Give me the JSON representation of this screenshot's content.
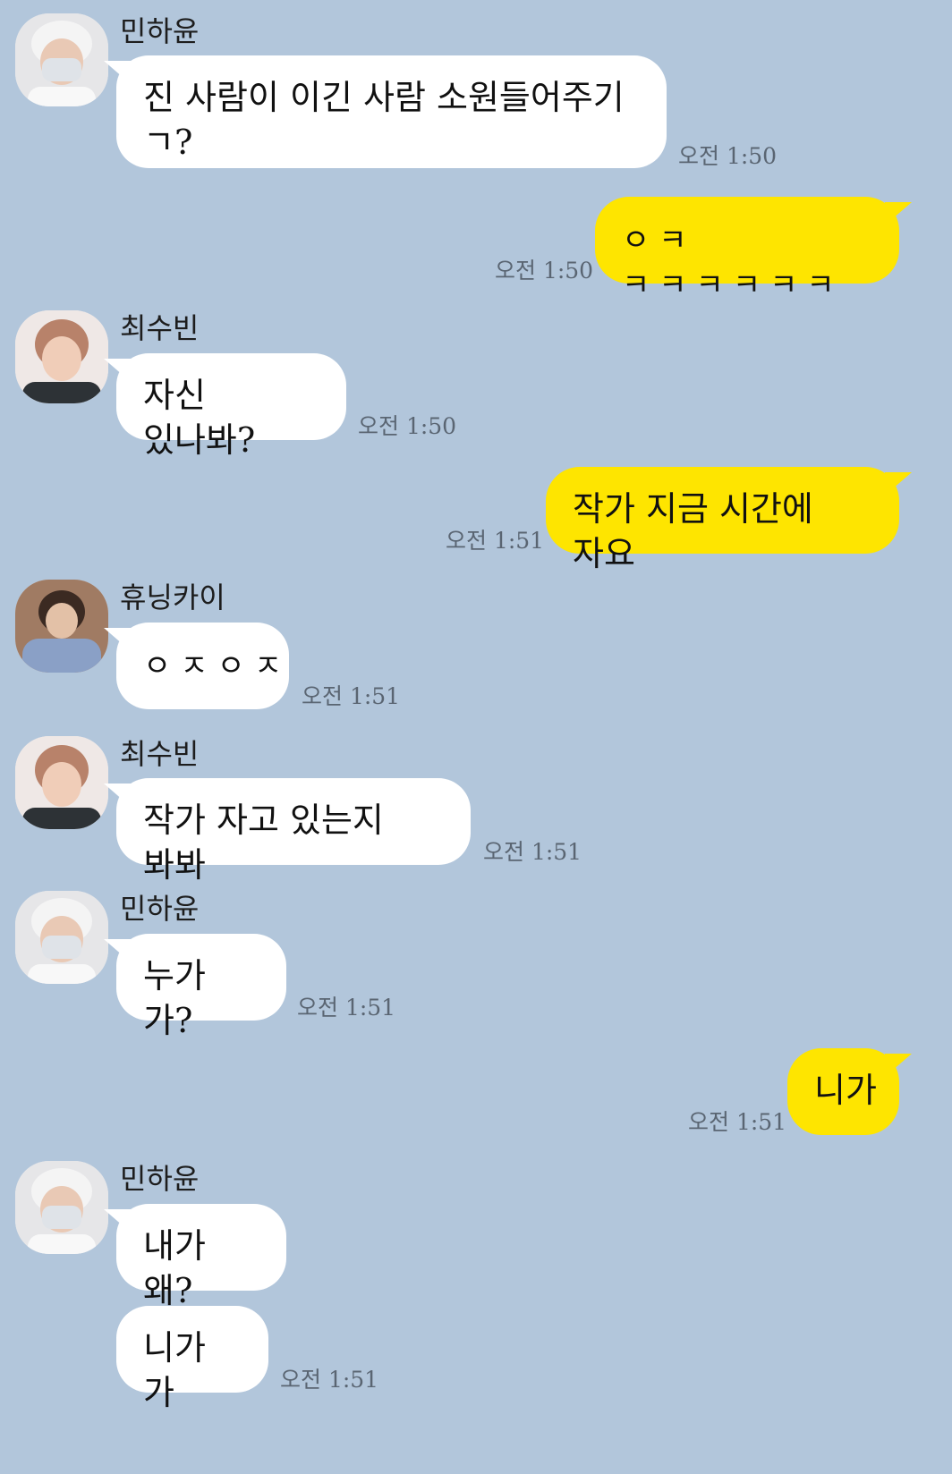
{
  "participants": {
    "minhayun": {
      "name": "민하윤"
    },
    "choisubin": {
      "name": "최수빈"
    },
    "hueningkai": {
      "name": "휴닝카이"
    }
  },
  "messages": [
    {
      "id": "m1",
      "sender": "민하윤",
      "text": "진 사람이 이긴 사람 소원들어주기\nㄱ?",
      "time": "오전 1:50"
    },
    {
      "id": "m2",
      "sender": "me",
      "text": "ㅇㅋ ㅋㅋㅋㅋㅋㅋ",
      "time": "오전 1:50"
    },
    {
      "id": "m3",
      "sender": "최수빈",
      "text": "자신 있나봐?",
      "time": "오전 1:50"
    },
    {
      "id": "m4",
      "sender": "me",
      "text": "작가 지금 시간에 자요",
      "time": "오전 1:51"
    },
    {
      "id": "m5",
      "sender": "휴닝카이",
      "text": "ㅇㅈㅇㅈ",
      "time": "오전 1:51"
    },
    {
      "id": "m6",
      "sender": "최수빈",
      "text": "작가 자고 있는지 봐봐",
      "time": "오전 1:51"
    },
    {
      "id": "m7",
      "sender": "민하윤",
      "text": "누가 가?",
      "time": "오전 1:51"
    },
    {
      "id": "m8",
      "sender": "me",
      "text": "니가",
      "time": "오전 1:51"
    },
    {
      "id": "m9",
      "sender": "민하윤",
      "text": "내가 왜?",
      "time": ""
    },
    {
      "id": "m10",
      "sender": "민하윤",
      "text": "니가 가",
      "time": "오전 1:51"
    }
  ],
  "colors": {
    "background": "#b2c6db",
    "incoming_bubble": "#ffffff",
    "outgoing_bubble": "#fee500",
    "timestamp": "#5a6572"
  }
}
